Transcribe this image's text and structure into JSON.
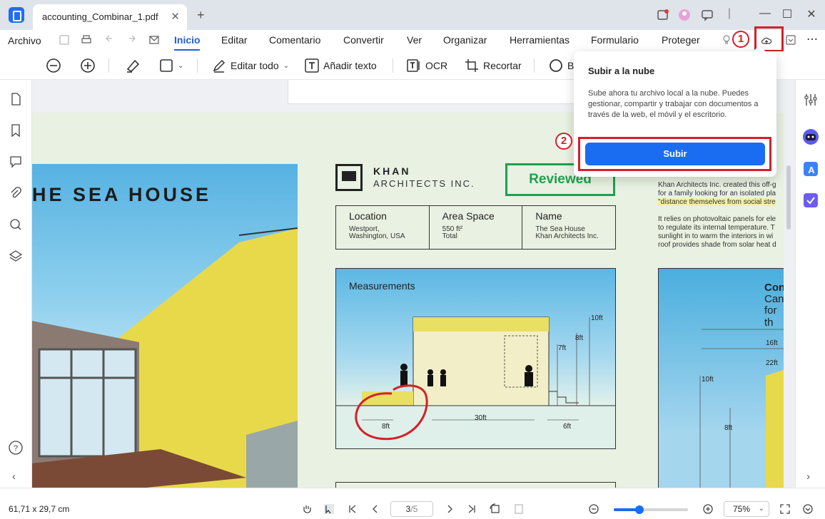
{
  "tab": {
    "title": "accounting_Combinar_1.pdf",
    "close": "✕",
    "new": "+"
  },
  "menu": {
    "archivo": "Archivo",
    "items": [
      "Inicio",
      "Editar",
      "Comentario",
      "Convertir",
      "Ver",
      "Organizar",
      "Herramientas",
      "Formulario",
      "Proteger"
    ],
    "active": "Inicio"
  },
  "toolbar": {
    "editar_todo": "Editar todo",
    "anadir_texto": "Añadir texto",
    "ocr": "OCR",
    "recortar": "Recortar",
    "partial": "B"
  },
  "document": {
    "sea_house_title": "HE SEA HOUSE",
    "khan_name": "KHAN",
    "khan_sub": "ARCHITECTS INC.",
    "stamp": "Reviewed",
    "info": [
      {
        "heading": "Location",
        "value_1": "Westport,",
        "value_2": "Washington, USA"
      },
      {
        "heading": "Area Space",
        "value_1": "550 ft²",
        "value_2": "Total"
      },
      {
        "heading": "Name",
        "value_1": "The Sea House",
        "value_2": "Khan Architects Inc."
      }
    ],
    "measurements": {
      "title": "Measurements",
      "labels": [
        "10ft",
        "8ft",
        "7ft",
        "8ft",
        "30ft",
        "6ft"
      ]
    },
    "right_text": {
      "line_1": "Khan Architects Inc. created this off-g",
      "line_2": "for a family looking for an isolated pla",
      "line_3": "\"distance themselves from social stre",
      "line_4": "It relies on photovoltaic panels for ele",
      "line_5": "to regulate its internal temperature. T",
      "line_6": "sunlight in to warm the interiors in wi",
      "line_7": "roof provides shade from solar heat d"
    },
    "right_photo": {
      "title_1": "Con",
      "title_2": "Can",
      "title_3": "for th",
      "labels": [
        "16ft",
        "22ft",
        "10ft",
        "8ft"
      ]
    }
  },
  "popover": {
    "title": "Subir a la nube",
    "description": "Sube ahora tu archivo local a la nube. Puedes gestionar, compartir y trabajar con documentos a través de la web, el móvil y el escritorio.",
    "button": "Subir"
  },
  "markers": {
    "one": "1",
    "two": "2"
  },
  "status": {
    "dimensions": "61,71 x 29,7 cm",
    "page_current": "3",
    "page_total": "/5",
    "zoom": "75%",
    "zoom_level": 0.35
  },
  "colors": {
    "accent": "#1a6cf0",
    "highlight": "#d3202a",
    "stamp": "#1fa04d"
  },
  "icons": {
    "left_sidebar": [
      "page-icon",
      "bookmark-icon",
      "comment-icon",
      "attachment-icon",
      "search-icon",
      "layers-icon",
      "help-icon"
    ],
    "right_sidebar": [
      "properties-icon",
      "ai-assistant-icon",
      "translate-icon",
      "task-icon"
    ]
  }
}
